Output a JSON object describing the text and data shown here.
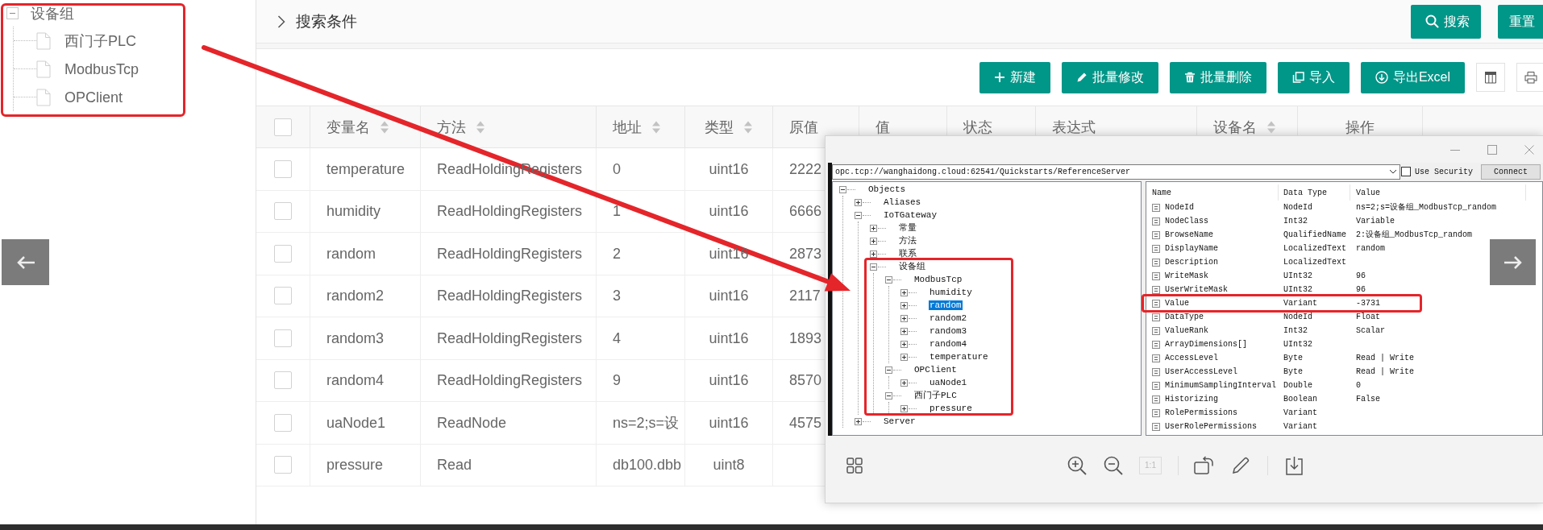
{
  "sidebar": {
    "tree": [
      {
        "label": "设备组",
        "expanded": true,
        "children": [
          {
            "label": "西门子PLC"
          },
          {
            "label": "ModbusTcp"
          },
          {
            "label": "OPClient"
          }
        ]
      }
    ]
  },
  "search_bar": {
    "title": "搜索条件",
    "expanded": false,
    "buttons": [
      "搜索",
      "重置"
    ]
  },
  "toolbar": {
    "buttons": [
      "新建",
      "批量修改",
      "批量删除",
      "导入",
      "导出Excel"
    ]
  },
  "table": {
    "all_checked": false,
    "columns": [
      {
        "label": "变量名",
        "sortable": true
      },
      {
        "label": "方法",
        "sortable": true
      },
      {
        "label": "地址",
        "sortable": true
      },
      {
        "label": "类型",
        "sortable": true
      },
      {
        "label": "原值",
        "sortable": false
      },
      {
        "label": "值",
        "sortable": false
      },
      {
        "label": "状态",
        "sortable": false
      },
      {
        "label": "表达式",
        "sortable": false
      },
      {
        "label": "设备名",
        "sortable": true
      },
      {
        "label": "操作",
        "sortable": false
      }
    ],
    "rows": [
      {
        "checked": false,
        "cells": [
          "temperature",
          "ReadHoldingRegisters",
          "0",
          "uint16",
          "2222"
        ]
      },
      {
        "checked": false,
        "cells": [
          "humidity",
          "ReadHoldingRegisters",
          "1",
          "uint16",
          "6666"
        ]
      },
      {
        "checked": false,
        "cells": [
          "random",
          "ReadHoldingRegisters",
          "2",
          "uint16",
          "2873"
        ]
      },
      {
        "checked": false,
        "cells": [
          "random2",
          "ReadHoldingRegisters",
          "3",
          "uint16",
          "2117"
        ]
      },
      {
        "checked": false,
        "cells": [
          "random3",
          "ReadHoldingRegisters",
          "4",
          "uint16",
          "1893"
        ]
      },
      {
        "checked": false,
        "cells": [
          "random4",
          "ReadHoldingRegisters",
          "9",
          "uint16",
          "8570"
        ]
      },
      {
        "checked": false,
        "cells": [
          "uaNode1",
          "ReadNode",
          "ns=2;s=设",
          "uint16",
          "4575"
        ]
      },
      {
        "checked": false,
        "cells": [
          "pressure",
          "Read",
          "db100.dbb",
          "uint8"
        ]
      }
    ]
  },
  "image_viewer": {
    "client_window": {
      "endpoint": "opc.tcp://wanghaidong.cloud:62541/Quickstarts/ReferenceServer",
      "use_security": {
        "label": "Use Security",
        "checked": false
      },
      "connect_button": "Connect",
      "tree": [
        {
          "label": "Objects",
          "expanded": true,
          "selected": false,
          "children": [
            {
              "label": "Aliases",
              "expanded": false,
              "selected": false
            },
            {
              "label": "IoTGateway",
              "expanded": true,
              "selected": false,
              "children": [
                {
                  "label": "常量",
                  "expanded": false,
                  "selected": false
                },
                {
                  "label": "方法",
                  "expanded": false,
                  "selected": false
                },
                {
                  "label": "联系",
                  "expanded": false,
                  "selected": false
                },
                {
                  "label": "设备组",
                  "expanded": true,
                  "selected": false,
                  "children": [
                    {
                      "label": "ModbusTcp",
                      "expanded": true,
                      "selected": false,
                      "children": [
                        {
                          "label": "humidity",
                          "expanded": false,
                          "selected": false
                        },
                        {
                          "label": "random",
                          "expanded": false,
                          "selected": true
                        },
                        {
                          "label": "random2",
                          "expanded": false,
                          "selected": false
                        },
                        {
                          "label": "random3",
                          "expanded": false,
                          "selected": false
                        },
                        {
                          "label": "random4",
                          "expanded": false,
                          "selected": false
                        },
                        {
                          "label": "temperature",
                          "expanded": false,
                          "selected": false
                        }
                      ]
                    },
                    {
                      "label": "OPClient",
                      "expanded": true,
                      "selected": false,
                      "children": [
                        {
                          "label": "uaNode1",
                          "expanded": false,
                          "selected": false
                        }
                      ]
                    },
                    {
                      "label": "西门子PLC",
                      "expanded": true,
                      "selected": false,
                      "children": [
                        {
                          "label": "pressure",
                          "expanded": false,
                          "selected": false
                        }
                      ]
                    }
                  ]
                }
              ]
            },
            {
              "label": "Server",
              "expanded": false,
              "selected": false
            }
          ]
        }
      ],
      "attributes": {
        "columns": [
          "Name",
          "Data Type",
          "Value"
        ],
        "rows": [
          [
            "NodeId",
            "NodeId",
            "ns=2;s=设备组_ModbusTcp_random"
          ],
          [
            "NodeClass",
            "Int32",
            "Variable"
          ],
          [
            "BrowseName",
            "QualifiedName",
            "2:设备组_ModbusTcp_random"
          ],
          [
            "DisplayName",
            "LocalizedText",
            "random"
          ],
          [
            "Description",
            "LocalizedText"
          ],
          [
            "WriteMask",
            "UInt32",
            "96"
          ],
          [
            "UserWriteMask",
            "UInt32",
            "96"
          ],
          [
            "Value",
            "Variant",
            "-3731"
          ],
          [
            "DataType",
            "NodeId",
            "Float"
          ],
          [
            "ValueRank",
            "Int32",
            "Scalar"
          ],
          [
            "ArrayDimensions[]",
            "UInt32"
          ],
          [
            "AccessLevel",
            "Byte",
            "Read | Write"
          ],
          [
            "UserAccessLevel",
            "Byte",
            "Read | Write"
          ],
          [
            "MinimumSamplingInterval",
            "Double",
            "0"
          ],
          [
            "Historizing",
            "Boolean",
            "False"
          ],
          [
            "RolePermissions",
            "Variant"
          ],
          [
            "UserRolePermissions",
            "Variant"
          ]
        ]
      }
    },
    "toolbar": {
      "actual_size": {
        "label": "1:1",
        "disabled": true
      }
    }
  }
}
